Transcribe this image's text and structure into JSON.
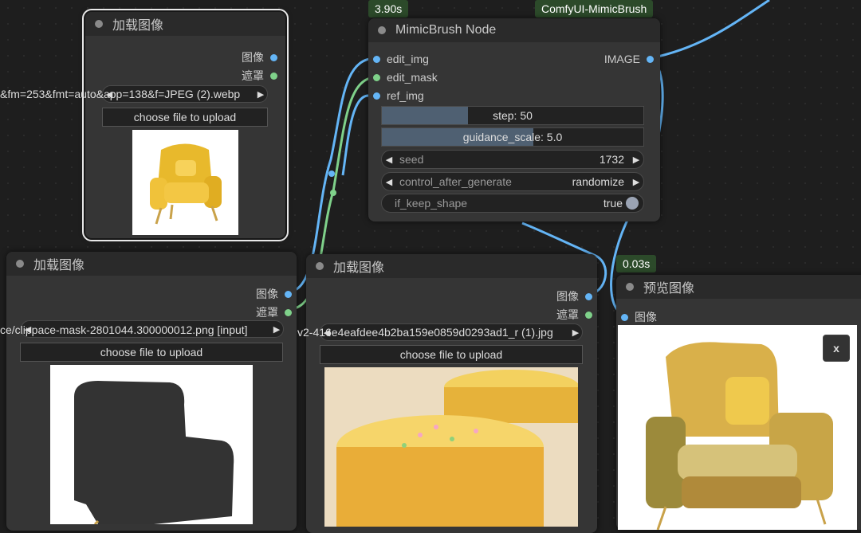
{
  "badges": {
    "timing_top": "3.90s",
    "group_name": "ComfyUI-MimicBrush",
    "timing_preview": "0.03s"
  },
  "load_image_1": {
    "title": "加载图像",
    "output_image": "图像",
    "output_mask": "遮罩",
    "file_value": "&fm=253&fmt=auto&app=138&f=JPEG (2).webp",
    "upload_label": "choose file to upload"
  },
  "mimicbrush": {
    "title": "MimicBrush Node",
    "inputs": [
      "edit_img",
      "edit_mask",
      "ref_img"
    ],
    "output": "IMAGE",
    "step_label": "step",
    "step_value": "50",
    "step_fill": 0.33,
    "guidance_label": "guidance_scale",
    "guidance_value": "5.0",
    "guidance_fill": 0.58,
    "seed_label": "seed",
    "seed_value": "1732",
    "control_label": "control_after_generate",
    "control_value": "randomize",
    "keep_label": "if_keep_shape",
    "keep_value": "true"
  },
  "load_image_2": {
    "title": "加载图像",
    "output_image": "图像",
    "output_mask": "遮罩",
    "file_value": "ce/clippace-mask-2801044.300000012.png [input]",
    "upload_label": "choose file to upload"
  },
  "load_image_3": {
    "title": "加载图像",
    "output_image": "图像",
    "output_mask": "遮罩",
    "file_value": "v2-416e4eafdee4b2ba159e0859d0293ad1_r (1).jpg",
    "upload_label": "choose file to upload"
  },
  "preview": {
    "title": "预览图像",
    "input_image": "图像",
    "close_label": "x"
  },
  "colors": {
    "image_wire": "#64b5f6",
    "mask_wire": "#7fd18a",
    "badge_bg": "#2c4a2a"
  }
}
